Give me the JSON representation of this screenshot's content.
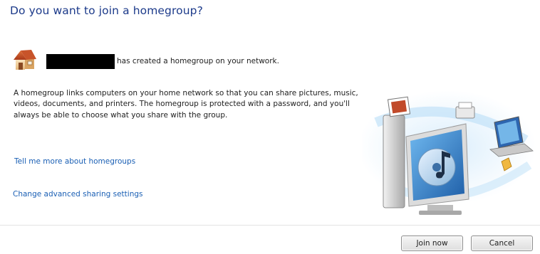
{
  "dialog": {
    "heading": "Do you want to join a homegroup?",
    "owner_text": "has created a homegroup on your network.",
    "description": "A homegroup links computers on your home network so that you can share pictures, music, videos, documents, and printers. The homegroup is protected with a password, and you'll always be able to choose what you share with the group.",
    "links": {
      "more": "Tell me more about homegroups",
      "advanced": "Change advanced sharing settings"
    },
    "buttons": {
      "join": "Join now",
      "cancel": "Cancel"
    }
  },
  "icons": {
    "homegroup": "house-icon",
    "illustration": "homegroup-devices-illustration"
  },
  "colors": {
    "heading": "#1c3a8a",
    "link": "#1a5fb4",
    "redacted": "#000000"
  }
}
